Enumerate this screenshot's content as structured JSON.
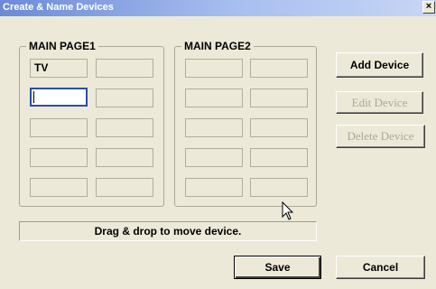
{
  "window": {
    "title": "Create & Name Devices",
    "close_label": "×"
  },
  "groups": [
    {
      "label": "MAIN PAGE1",
      "slots": [
        "TV",
        "",
        "",
        "",
        "",
        "",
        "",
        "",
        "",
        ""
      ]
    },
    {
      "label": "MAIN PAGE2",
      "slots": [
        "",
        "",
        "",
        "",
        "",
        "",
        "",
        "",
        "",
        ""
      ]
    }
  ],
  "selected_slot": {
    "group": 0,
    "index": 2
  },
  "buttons": {
    "add": "Add Device",
    "edit": "Edit Device",
    "delete": "Delete Device",
    "save": "Save",
    "cancel": "Cancel"
  },
  "status_text": "Drag & drop to move device.",
  "icons": {
    "cursor": "arrow-cursor-icon",
    "close": "close-icon"
  }
}
